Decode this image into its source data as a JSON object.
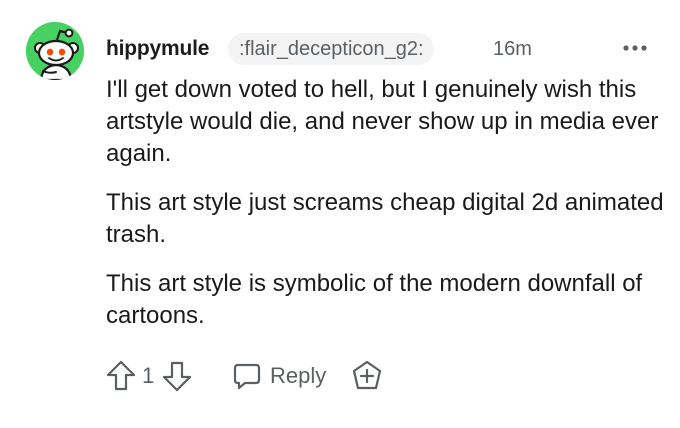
{
  "comment": {
    "username": "hippymule",
    "flair": ":flair_decepticon_g2:",
    "timestamp": "16m",
    "paragraphs": [
      "I'll get down voted to hell, but I genuinely wish this artstyle would die, and never show up in media ever again.",
      "This art style just screams cheap digital 2d animated trash.",
      "This art style is symbolic of the modern downfall of cartoons."
    ],
    "vote_count": "1",
    "reply_label": "Reply"
  },
  "icons": {
    "avatar": "snoo-avatar",
    "more": "more-options-icon",
    "upvote": "upvote-arrow-icon",
    "downvote": "downvote-arrow-icon",
    "reply": "speech-bubble-icon",
    "award": "award-plus-icon"
  },
  "colors": {
    "avatar_bg": "#46d160",
    "text": "#1a1a1b",
    "meta": "#5a5f63",
    "flair_bg": "#f4f4f5"
  }
}
